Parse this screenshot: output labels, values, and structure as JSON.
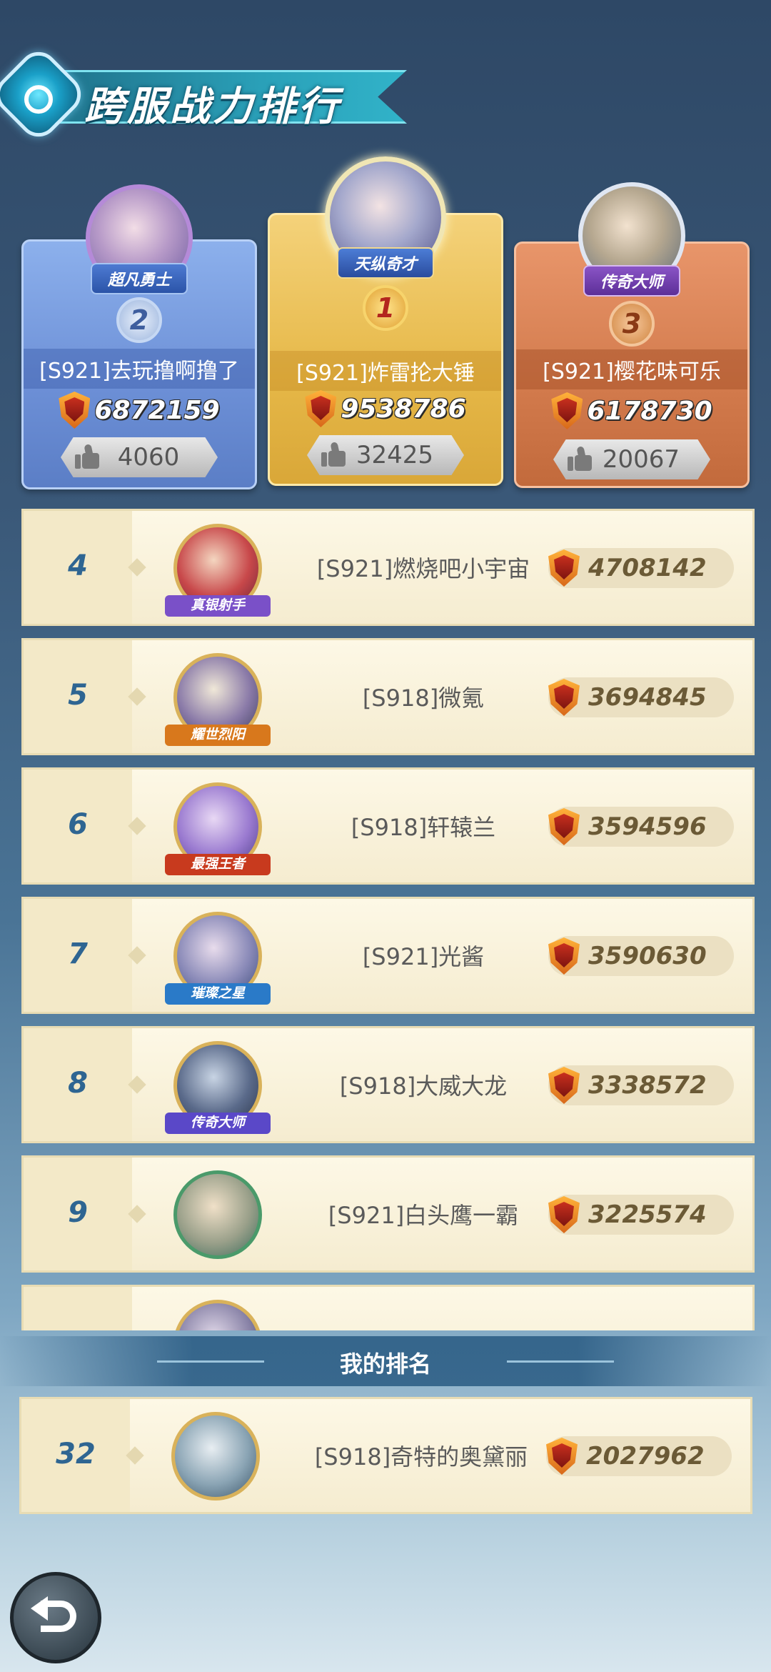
{
  "title": "跨服战力排行",
  "podium": [
    {
      "rank": "2",
      "tier": "超凡勇士",
      "name": "[S921]去玩撸啊撸了",
      "power": "6872159",
      "likes": "4060"
    },
    {
      "rank": "1",
      "tier": "天纵奇才",
      "name": "[S921]炸雷抡大锤",
      "power": "9538786",
      "likes": "32425"
    },
    {
      "rank": "3",
      "tier": "传奇大师",
      "name": "[S921]樱花味可乐",
      "power": "6178730",
      "likes": "20067"
    }
  ],
  "list": [
    {
      "rank": "4",
      "tier": "真银射手",
      "tier_color": "#7a50c8",
      "name": "[S921]燃烧吧小宇宙",
      "power": "4708142"
    },
    {
      "rank": "5",
      "tier": "耀世烈阳",
      "tier_color": "#d8781c",
      "name": "[S918]微氪",
      "power": "3694845"
    },
    {
      "rank": "6",
      "tier": "最强王者",
      "tier_color": "#c83a1e",
      "name": "[S918]轩辕兰",
      "power": "3594596"
    },
    {
      "rank": "7",
      "tier": "璀璨之星",
      "tier_color": "#2a7ac8",
      "name": "[S921]光酱",
      "power": "3590630"
    },
    {
      "rank": "8",
      "tier": "传奇大师",
      "tier_color": "#5a48c8",
      "name": "[S918]大威大龙",
      "power": "3338572"
    },
    {
      "rank": "9",
      "tier": "",
      "tier_color": "",
      "name": "[S921]白头鹰一霸",
      "power": "3225574"
    }
  ],
  "my_rank": {
    "label": "我的排名",
    "rank": "32",
    "name": "[S918]奇特的奥黛丽",
    "power": "2027962"
  },
  "icons": {
    "power": "shield-power-icon",
    "like": "thumbs-up-icon",
    "back": "back-arrow-icon"
  }
}
